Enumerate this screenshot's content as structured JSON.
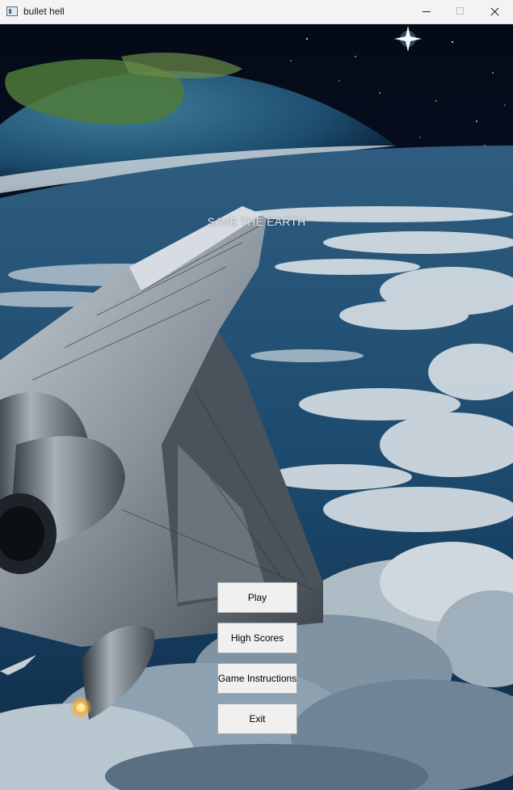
{
  "window": {
    "title": "bullet hell"
  },
  "menu": {
    "subtitle": "SAVE THE EARTH",
    "buttons": [
      {
        "label": "Play"
      },
      {
        "label": "High Scores"
      },
      {
        "label": "Game Instructions"
      },
      {
        "label": "Exit"
      }
    ]
  },
  "icons": [
    "app-icon",
    "minimize-icon",
    "maximize-icon",
    "close-icon"
  ],
  "colors": {
    "space": "#0a1428",
    "ocean": "#1c4a6e",
    "cloud": "#dfe6ea",
    "hull": "#9aa4ae",
    "button_bg": "#f0f0f0"
  }
}
